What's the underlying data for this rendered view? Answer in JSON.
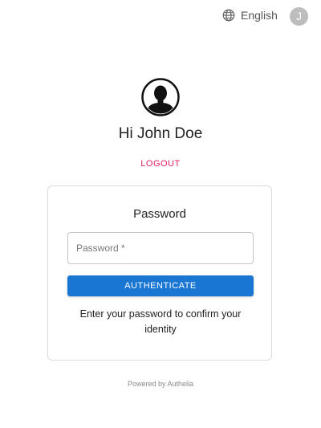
{
  "header": {
    "language_label": "English",
    "language_icon": "globe-icon",
    "account_initial": "J"
  },
  "user": {
    "avatar_icon": "user-silhouette-icon",
    "greeting": "Hi John Doe",
    "logout_label": "LOGOUT"
  },
  "card": {
    "title": "Password",
    "password_placeholder": "Password *",
    "password_value": "",
    "authenticate_label": "AUTHENTICATE",
    "hint": "Enter your password to confirm your identity"
  },
  "footer": {
    "powered_by": "Powered by Authelia"
  },
  "colors": {
    "primary": "#1976d2",
    "logout": "#e91e63",
    "avatar_bg": "#bdbdbd"
  }
}
